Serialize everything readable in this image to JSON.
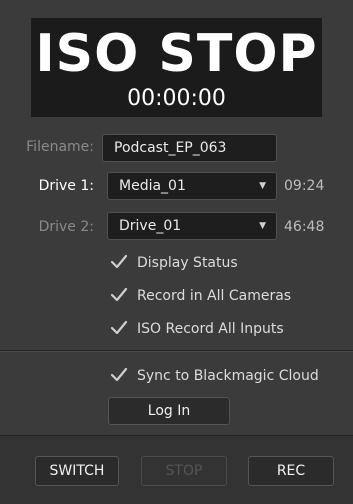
{
  "header": {
    "status_title": "ISO STOP",
    "timecode": "00:00:00"
  },
  "filename": {
    "label": "Filename:",
    "value": "Podcast_EP_063"
  },
  "drive1": {
    "label": "Drive 1:",
    "value": "Media_01",
    "remaining": "09:24"
  },
  "drive2": {
    "label": "Drive 2:",
    "value": "Drive_01",
    "remaining": "46:48"
  },
  "options": [
    {
      "label": "Display Status",
      "checked": true
    },
    {
      "label": "Record in All Cameras",
      "checked": true
    },
    {
      "label": "ISO Record All Inputs",
      "checked": true
    }
  ],
  "cloud": {
    "sync_label": "Sync to Blackmagic Cloud",
    "sync_checked": true,
    "login_label": "Log In"
  },
  "footer": {
    "switch_label": "SWITCH",
    "stop_label": "STOP",
    "rec_label": "REC"
  },
  "colors": {
    "panel_bg": "#3b3b3b",
    "header_bg": "#1b1b1b",
    "field_bg": "#1e1e1e",
    "checkmark": "#cfcfcf"
  }
}
